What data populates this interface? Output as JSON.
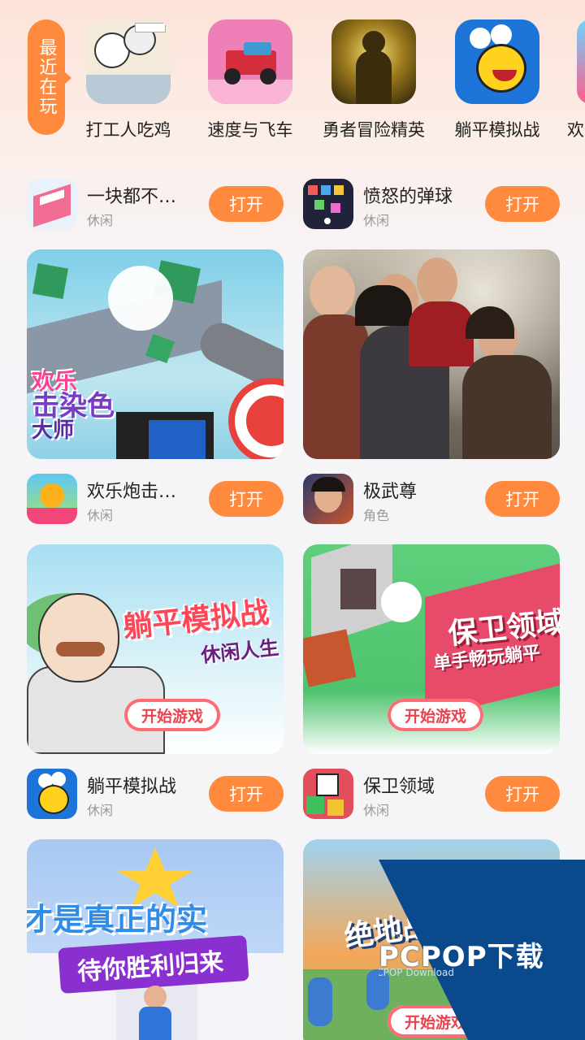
{
  "recent": {
    "tag_label": "最近在玩",
    "items": [
      {
        "name": "打工人吃鸡"
      },
      {
        "name": "速度与飞车"
      },
      {
        "name": "勇者冒险精英"
      },
      {
        "name": "躺平模拟战"
      },
      {
        "name": "欢"
      }
    ]
  },
  "apps": [
    {
      "name": "一块都不…",
      "category": "休闲",
      "button": "打开"
    },
    {
      "name": "愤怒的弹球",
      "category": "休闲",
      "button": "打开"
    },
    {
      "name": "欢乐炮击…",
      "category": "休闲",
      "button": "打开"
    },
    {
      "name": "极武尊",
      "category": "角色",
      "button": "打开"
    },
    {
      "name": "躺平模拟战",
      "category": "休闲",
      "button": "打开"
    },
    {
      "name": "保卫领域",
      "category": "休闲",
      "button": "打开"
    }
  ],
  "banners": {
    "b1": {
      "title_line1": "欢乐",
      "title_line2": "击染色",
      "title_line3": "大师"
    },
    "b3": {
      "title": "躺平模拟战",
      "subtitle": "休闲人生",
      "start": "开始游戏"
    },
    "b4": {
      "title": "保卫领域",
      "subtitle": "单手畅玩躺平",
      "start": "开始游戏"
    },
    "b5": {
      "title": "才是真正的实",
      "subtitle": "待你胜利归来"
    },
    "b6": {
      "title": "绝地战",
      "start": "开始游戏"
    }
  },
  "watermark": {
    "brand": "PCPOP下载",
    "sub": "PCPOP Download"
  },
  "colors": {
    "accent": "#ff8a3d",
    "category_text": "#999999",
    "start_text": "#e8434e"
  }
}
